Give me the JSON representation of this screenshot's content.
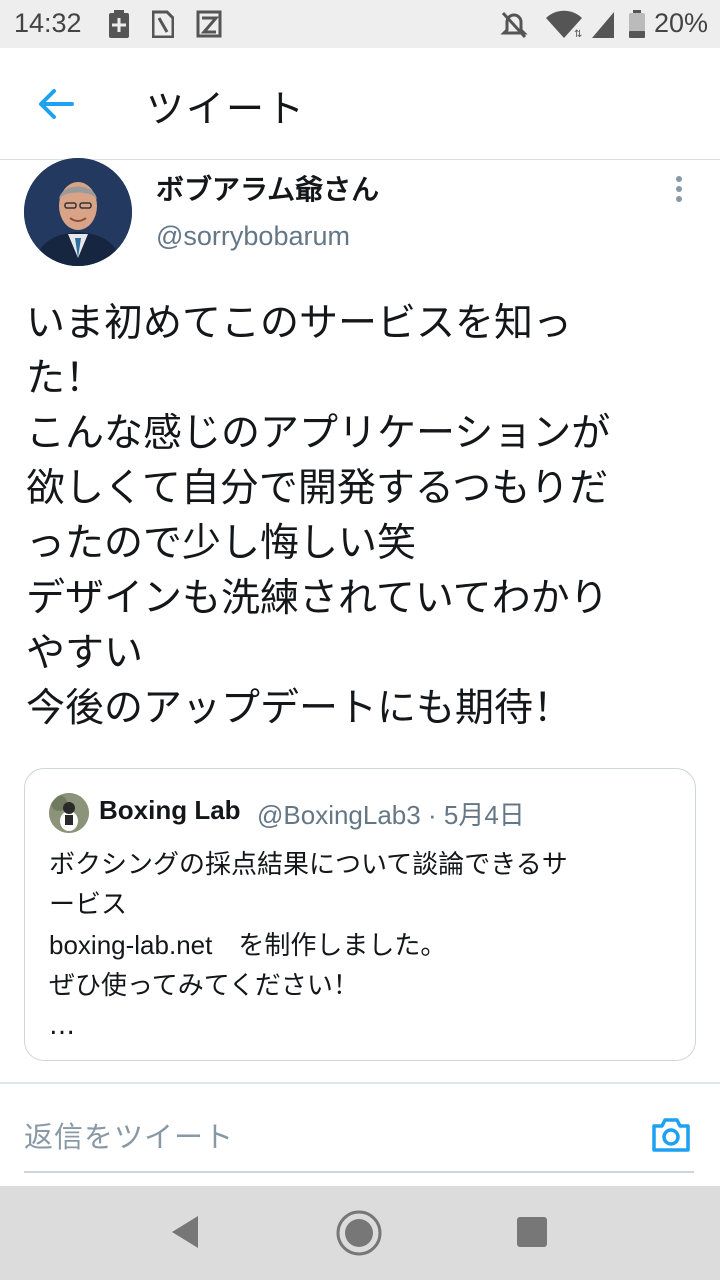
{
  "status_bar": {
    "time": "14:32",
    "battery_percent": "20%",
    "icons": [
      "battery-saver-icon",
      "sim-card-icon",
      "app-notification-icon",
      "do-not-disturb-off-icon",
      "wifi-icon",
      "cell-signal-icon",
      "battery-icon"
    ]
  },
  "header": {
    "title": "ツイート",
    "back_icon": "arrow-left-icon"
  },
  "tweet": {
    "display_name": "ボブアラム爺さん",
    "handle": "@sorrybobarum",
    "text": "いま初めてこのサービスを知っ\nた！\nこんな感じのアプリケーションが\n欲しくて自分で開発するつもりだ\nったので少し悔しい笑\nデザインも洗練されていてわかり\nやすい\n今後のアップデートにも期待！",
    "more_icon": "more-vertical-icon"
  },
  "quote": {
    "name": "Boxing Lab",
    "handle": "@BoxingLab3",
    "separator": "·",
    "date": "5月4日",
    "text_line1": "ボクシングの採点結果について談論できるサ\nービス",
    "url": "boxing-lab.net",
    "text_line2": "　を制作しました。\nぜひ使ってみてください！\n…"
  },
  "reply": {
    "placeholder": "返信をツイート",
    "camera_icon": "camera-icon"
  },
  "nav": {
    "icons": [
      "nav-back-icon",
      "nav-home-icon",
      "nav-recents-icon"
    ]
  },
  "colors": {
    "accent": "#1da1f2",
    "text": "#14171a",
    "secondary_text": "#657786",
    "border": "#ccd6dd",
    "status_bar_bg": "#eeeeee",
    "nav_bar_bg": "#dcdcdc"
  }
}
